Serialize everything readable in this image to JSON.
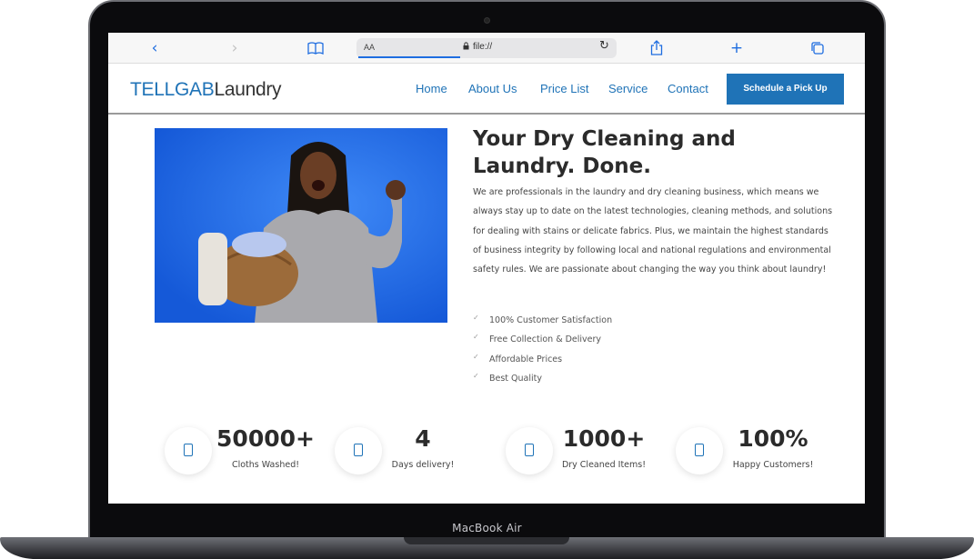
{
  "device": {
    "label": "MacBook Air"
  },
  "browser": {
    "address_text_size": "AA",
    "url": "file://",
    "back_icon": "chevron-left-icon",
    "forward_icon": "chevron-right-icon",
    "bookmarks_icon": "book-icon",
    "share_icon": "share-icon",
    "new_tab_icon": "plus-icon",
    "tabs_icon": "tabs-icon",
    "accent": "#1e6de0"
  },
  "site": {
    "logo_part1": "TELLGAB",
    "logo_part2": "Laundry",
    "nav": [
      "Home",
      "About Us",
      "Price List",
      "Service",
      "Contact"
    ],
    "cta_label": "Schedule a Pick Up",
    "brand_color": "#1f73b7"
  },
  "hero": {
    "title": "Your Dry Cleaning and Laundry. Done.",
    "text": "We are professionals in the laundry and dry cleaning business, which means we always stay up to date on the latest technologies, cleaning methods, and solutions for dealing with stains or delicate fabrics. Plus, we maintain the highest standards of business integrity by following local and national regulations and environmental safety rules. We are passionate about changing the way you think about laundry!",
    "checklist": [
      "100% Customer Satisfaction",
      "Free Collection & Delivery",
      "Affordable Prices",
      "Best Quality"
    ],
    "check_glyph": "✓"
  },
  "stats": [
    {
      "value": "50000+",
      "label": "Cloths Washed!",
      "icon": "phone-icon"
    },
    {
      "value": "4",
      "label": "Days delivery!",
      "icon": "phone-icon"
    },
    {
      "value": "1000+",
      "label": "Dry Cleaned Items!",
      "icon": "phone-icon"
    },
    {
      "value": "100%",
      "label": "Happy Customers!",
      "icon": "phone-icon"
    }
  ]
}
